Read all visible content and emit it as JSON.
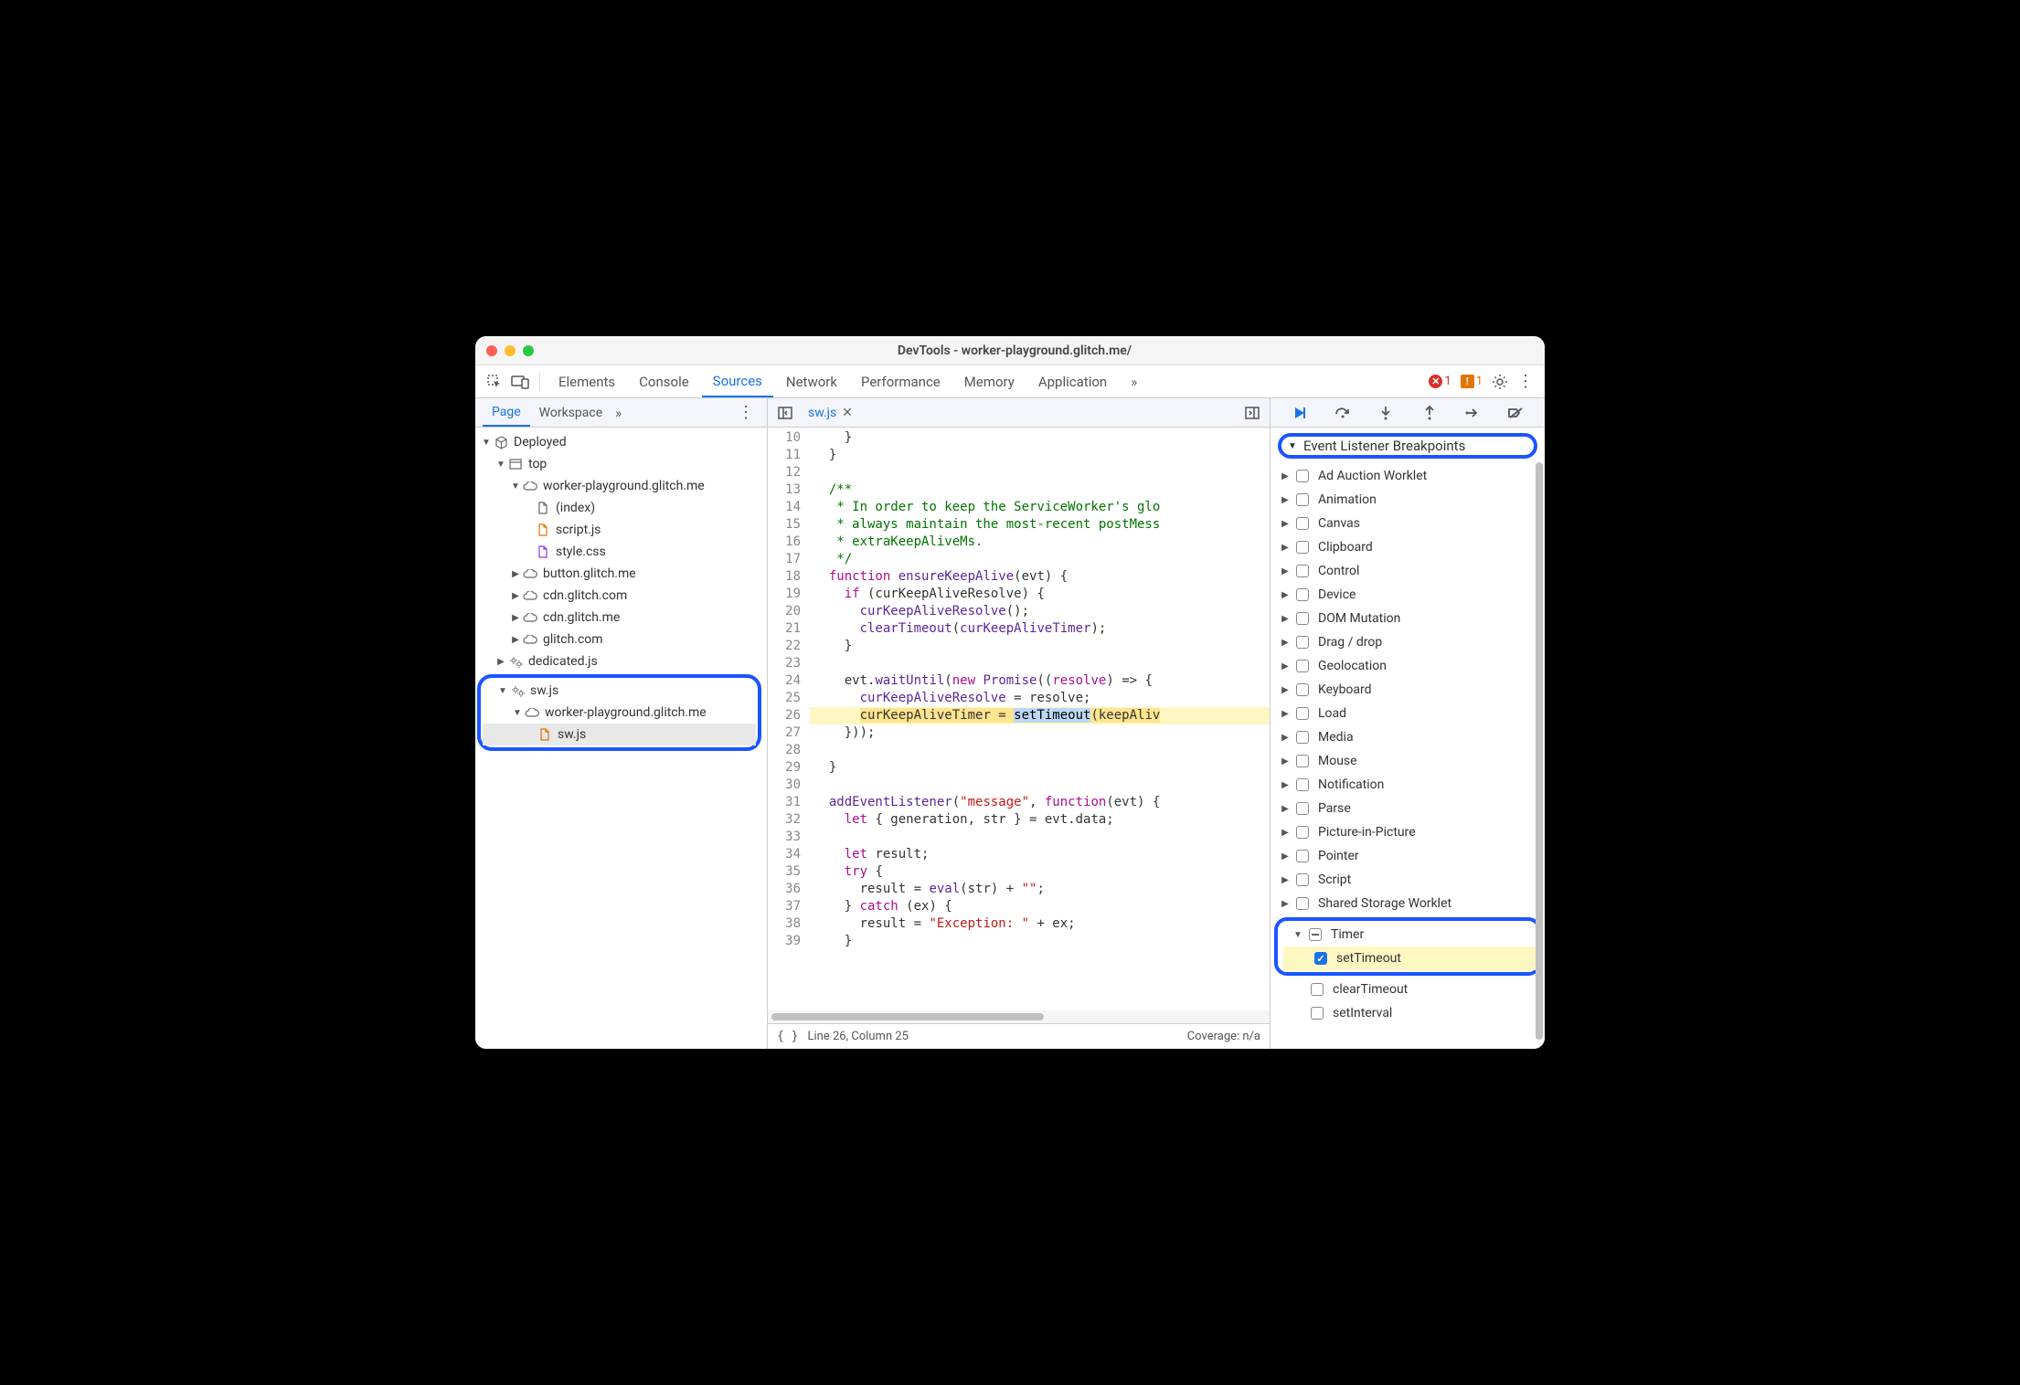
{
  "window": {
    "title": "DevTools - worker-playground.glitch.me/"
  },
  "toolbar": {
    "tabs": [
      "Elements",
      "Console",
      "Sources",
      "Network",
      "Performance",
      "Memory",
      "Application"
    ],
    "activeTab": "Sources",
    "more": "»",
    "errorCount": "1",
    "warnCount": "1"
  },
  "leftPanel": {
    "subtabs": [
      "Page",
      "Workspace"
    ],
    "activeSubtab": "Page",
    "more": "»",
    "tree": {
      "root": "Deployed",
      "top": "top",
      "domain1": "worker-playground.glitch.me",
      "index": "(index)",
      "scriptjs": "script.js",
      "stylecss": "style.css",
      "btn": "button.glitch.me",
      "cdncom": "cdn.glitch.com",
      "cdnme": "cdn.glitch.me",
      "glitch": "glitch.com",
      "dedicated": "dedicated.js",
      "swroot": "sw.js",
      "swdomain": "worker-playground.glitch.me",
      "swfile": "sw.js"
    }
  },
  "editor": {
    "fileName": "sw.js",
    "lines": [
      {
        "n": "10",
        "t": "    }"
      },
      {
        "n": "11",
        "t": "  }"
      },
      {
        "n": "12",
        "t": ""
      },
      {
        "n": "13",
        "t": "  /**",
        "cls": "com"
      },
      {
        "n": "14",
        "t": "   * In order to keep the ServiceWorker's glo",
        "cls": "com"
      },
      {
        "n": "15",
        "t": "   * always maintain the most-recent postMess",
        "cls": "com"
      },
      {
        "n": "16",
        "t": "   * extraKeepAliveMs.",
        "cls": "com"
      },
      {
        "n": "17",
        "t": "   */",
        "cls": "com"
      },
      {
        "n": "18",
        "t": "  function ensureKeepAlive(evt) {",
        "cls": "fn"
      },
      {
        "n": "19",
        "t": "    if (curKeepAliveResolve) {",
        "cls": "kw"
      },
      {
        "n": "20",
        "t": "      curKeepAliveResolve();"
      },
      {
        "n": "21",
        "t": "      clearTimeout(curKeepAliveTimer);"
      },
      {
        "n": "22",
        "t": "    }"
      },
      {
        "n": "23",
        "t": ""
      },
      {
        "n": "24",
        "t": "    evt.waitUntil(new Promise((resolve) => {",
        "cls": "kw2"
      },
      {
        "n": "25",
        "t": "      curKeepAliveResolve = resolve;"
      },
      {
        "n": "26",
        "t": "      curKeepAliveTimer = setTimeout(keepAliv",
        "hl": true,
        "paused": "setTimeout"
      },
      {
        "n": "27",
        "t": "    }));"
      },
      {
        "n": "28",
        "t": ""
      },
      {
        "n": "29",
        "t": "  }"
      },
      {
        "n": "30",
        "t": ""
      },
      {
        "n": "31",
        "t": "  addEventListener(\"message\", function(evt) {",
        "cls": "kw3"
      },
      {
        "n": "32",
        "t": "    let { generation, str } = evt.data;",
        "cls": "kw4"
      },
      {
        "n": "33",
        "t": ""
      },
      {
        "n": "34",
        "t": "    let result;",
        "cls": "kw4"
      },
      {
        "n": "35",
        "t": "    try {",
        "cls": "kw"
      },
      {
        "n": "36",
        "t": "      result = eval(str) + \"\";",
        "cls": "kw5"
      },
      {
        "n": "37",
        "t": "    } catch (ex) {",
        "cls": "kw"
      },
      {
        "n": "38",
        "t": "      result = \"Exception: \" + ex;",
        "cls": "str"
      },
      {
        "n": "39",
        "t": "    }"
      }
    ],
    "status": {
      "pos": "Line 26, Column 25",
      "coverage": "Coverage: n/a"
    }
  },
  "rightPanel": {
    "sectionTitle": "Event Listener Breakpoints",
    "categories": [
      "Ad Auction Worklet",
      "Animation",
      "Canvas",
      "Clipboard",
      "Control",
      "Device",
      "DOM Mutation",
      "Drag / drop",
      "Geolocation",
      "Keyboard",
      "Load",
      "Media",
      "Mouse",
      "Notification",
      "Parse",
      "Picture-in-Picture",
      "Pointer",
      "Script",
      "Shared Storage Worklet"
    ],
    "timer": {
      "label": "Timer",
      "setTimeout": "setTimeout",
      "clearTimeout": "clearTimeout",
      "setInterval": "setInterval"
    }
  }
}
